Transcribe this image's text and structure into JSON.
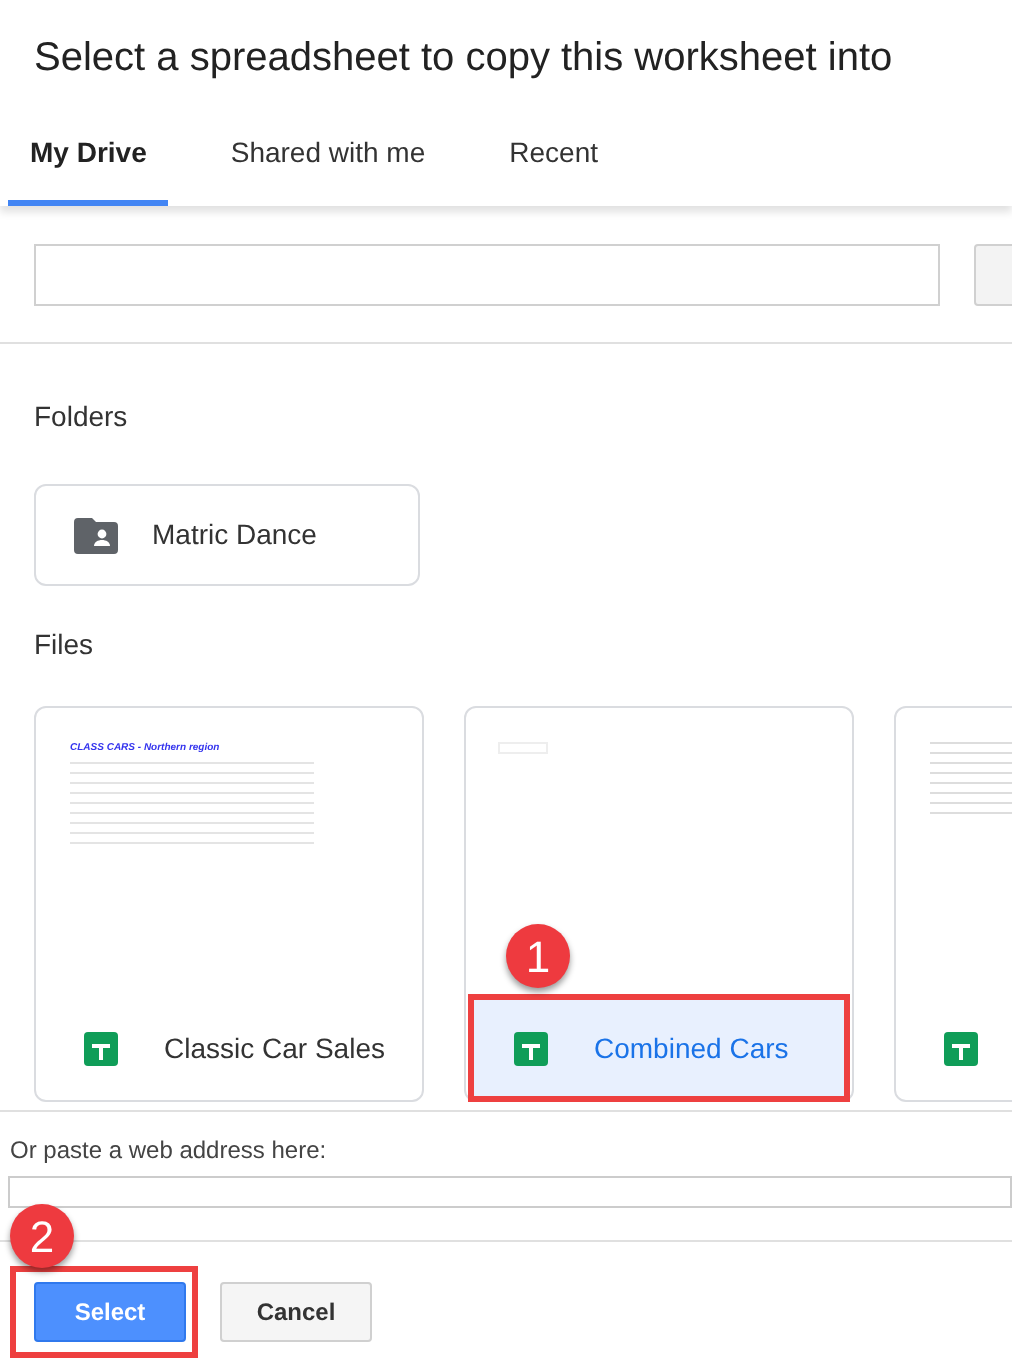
{
  "dialog": {
    "title": "Select a spreadsheet to copy this worksheet into"
  },
  "tabs": [
    {
      "label": "My Drive",
      "selected": true
    },
    {
      "label": "Shared with me",
      "selected": false
    },
    {
      "label": "Recent",
      "selected": false
    }
  ],
  "folders_heading": "Folders",
  "folders": [
    {
      "name": "Matric Dance"
    }
  ],
  "files_heading": "Files",
  "files": [
    {
      "name": "Classic Car Sales",
      "selected": false,
      "preview_title": "CLASS CARS - Northern region"
    },
    {
      "name": "Combined Cars",
      "selected": true,
      "callout": "1"
    },
    {
      "selected": false
    }
  ],
  "url_label": "Or paste a web address here:",
  "buttons": [
    {
      "label": "Select",
      "kind": "primary",
      "callout": "2"
    },
    {
      "label": "Cancel",
      "kind": "secondary"
    }
  ]
}
